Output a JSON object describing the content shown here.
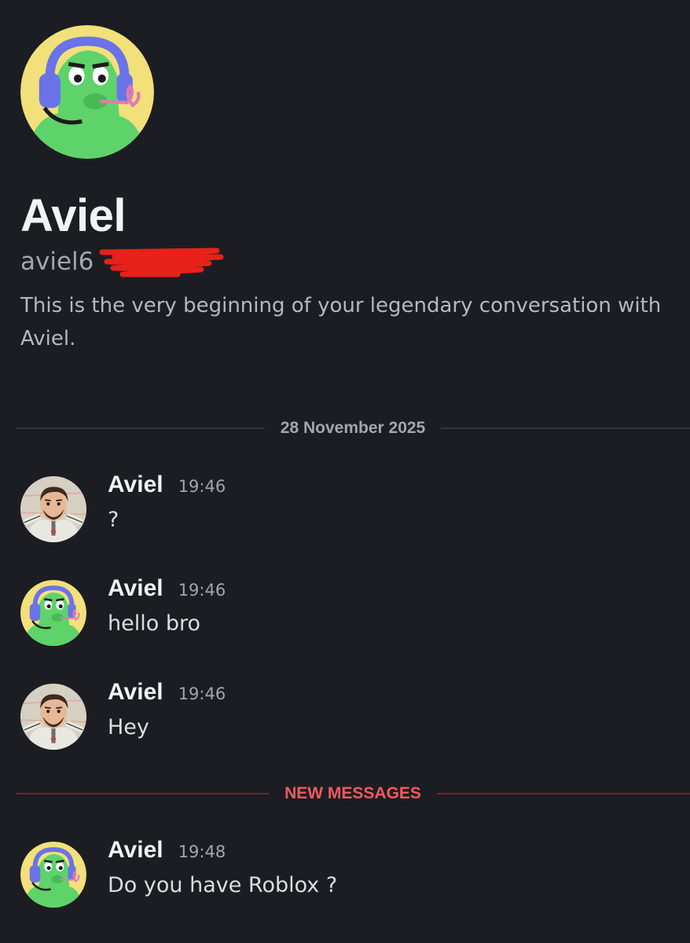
{
  "profile": {
    "display_name": "Aviel",
    "username": "aviel6",
    "intro": "This is the very beginning of your legendary conversation with Aviel."
  },
  "date_divider": "28 November 2025",
  "new_messages_divider": "NEW MESSAGES",
  "messages": [
    {
      "author": "Aviel",
      "time": "19:46",
      "text": "?",
      "avatar": "cartoon-man-avatar"
    },
    {
      "author": "Aviel",
      "time": "19:46",
      "text": "hello bro",
      "avatar": "green-headset-avatar"
    },
    {
      "author": "Aviel",
      "time": "19:46",
      "text": "Hey",
      "avatar": "cartoon-man-avatar"
    },
    {
      "author": "Aviel",
      "time": "19:48",
      "text": "Do you have Roblox ?",
      "avatar": "green-headset-avatar"
    }
  ],
  "colors": {
    "background": "#1c1d22",
    "name": "#f2f3f5",
    "muted": "#a3a6ad",
    "new_messages": "#f05a5f",
    "redaction": "#e8211a"
  }
}
